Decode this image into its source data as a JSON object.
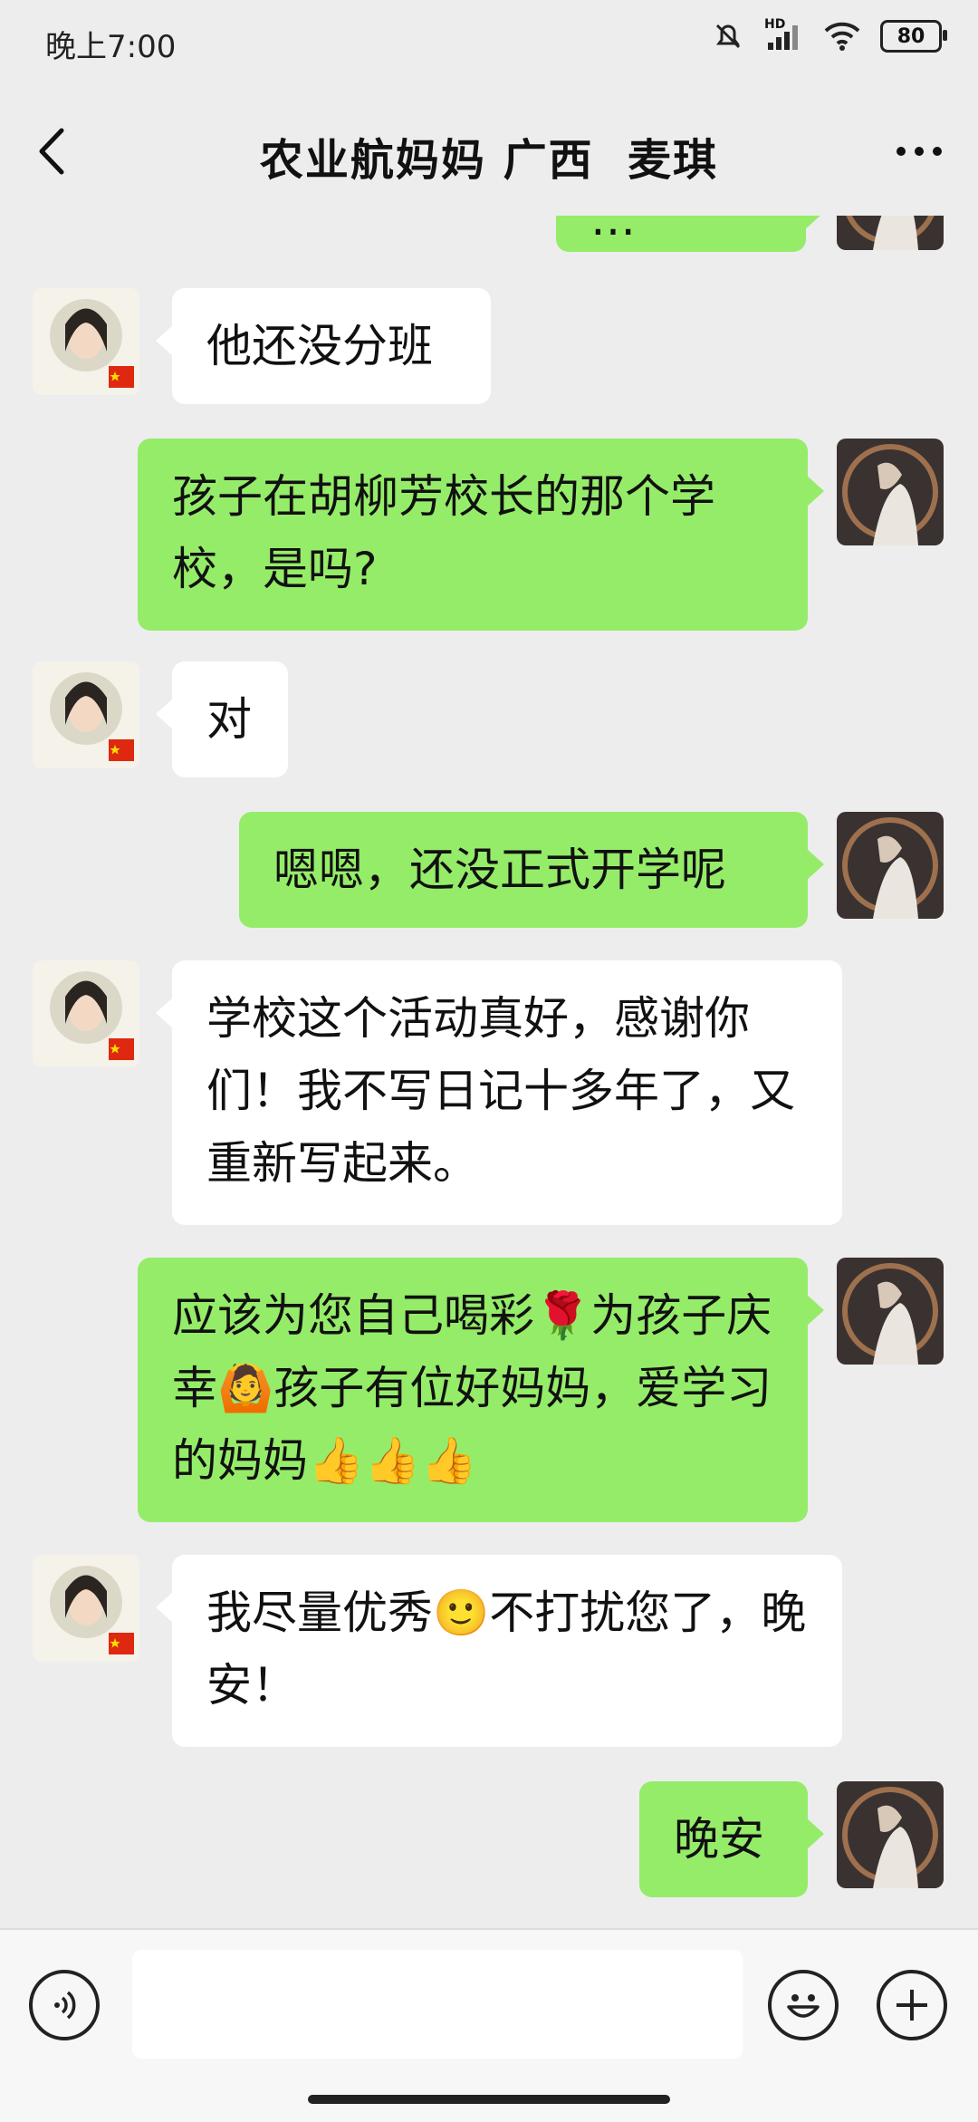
{
  "status_bar": {
    "time": "晚上7:00",
    "battery": "80",
    "network": "HD"
  },
  "header": {
    "title": "农业航妈妈 广西  麦琪"
  },
  "messages": [
    {
      "from": "me",
      "text": "…"
    },
    {
      "from": "them",
      "text": "他还没分班"
    },
    {
      "from": "me",
      "text": "孩子在胡柳芳校长的那个学校，是吗?"
    },
    {
      "from": "them",
      "text": "对"
    },
    {
      "from": "me",
      "text": "嗯嗯，还没正式开学呢"
    },
    {
      "from": "them",
      "text": "学校这个活动真好，感谢你们！我不写日记十多年了，又重新写起来。"
    },
    {
      "from": "me",
      "text": "应该为您自己喝彩🌹为孩子庆幸🙆孩子有位好妈妈，爱学习的妈妈👍👍👍"
    },
    {
      "from": "them",
      "text": "我尽量优秀🙂不打扰您了，晚安！"
    },
    {
      "from": "me",
      "text": "晚安"
    }
  ],
  "input": {
    "placeholder": ""
  },
  "colors": {
    "incoming_bubble": "#ffffff",
    "outgoing_bubble": "#95ec69",
    "background": "#ededed"
  }
}
